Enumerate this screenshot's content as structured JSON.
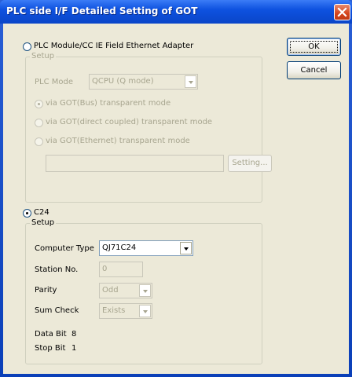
{
  "window": {
    "title": "PLC side I/F Detailed Setting of GOT"
  },
  "buttons": {
    "ok": "OK",
    "cancel": "Cancel"
  },
  "plc_module": {
    "radio_label": "PLC Module/CC IE Field Ethernet Adapter",
    "selected": false,
    "setup_label": "Setup",
    "plc_mode_label": "PLC Mode",
    "plc_mode_value": "QCPU (Q mode)",
    "options": [
      "via GOT(Bus) transparent mode",
      "via GOT(direct coupled) transparent mode",
      "via GOT(Ethernet) transparent mode"
    ],
    "setting_button": "Setting..."
  },
  "c24": {
    "radio_label": "C24",
    "selected": true,
    "setup_label": "Setup",
    "computer_type_label": "Computer Type",
    "computer_type_value": "QJ71C24",
    "station_label": "Station No.",
    "station_value": "0",
    "parity_label": "Parity",
    "parity_value": "Odd",
    "sum_check_label": "Sum Check",
    "sum_check_value": "Exists",
    "data_bit_label": "Data Bit",
    "data_bit_value": "8",
    "stop_bit_label": "Stop Bit",
    "stop_bit_value": "1"
  }
}
